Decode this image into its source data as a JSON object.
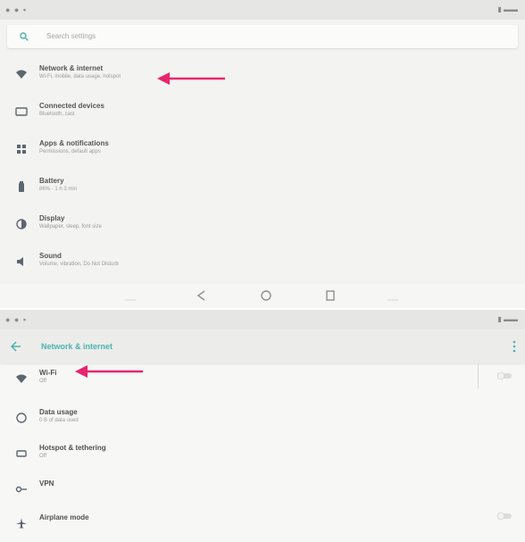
{
  "top": {
    "search_placeholder": "Search settings",
    "items": [
      {
        "title": "Network & internet",
        "summary": "Wi-Fi, mobile, data usage, hotspot",
        "icon": "wifi-icon"
      },
      {
        "title": "Connected devices",
        "summary": "Bluetooth, cast",
        "icon": "devices-icon"
      },
      {
        "title": "Apps & notifications",
        "summary": "Permissions, default apps",
        "icon": "apps-icon"
      },
      {
        "title": "Battery",
        "summary": "86% - 1 h 3 min",
        "icon": "battery-icon"
      },
      {
        "title": "Display",
        "summary": "Wallpaper, sleep, font size",
        "icon": "display-icon"
      },
      {
        "title": "Sound",
        "summary": "Volume, vibration, Do Not Disturb",
        "icon": "sound-icon"
      }
    ]
  },
  "bottom": {
    "title": "Network & internet",
    "items": [
      {
        "title": "Wi-Fi",
        "summary": "Off",
        "icon": "wifi-icon"
      },
      {
        "title": "Data usage",
        "summary": "0 B of data used",
        "icon": "data-usage-icon"
      },
      {
        "title": "Hotspot & tethering",
        "summary": "Off",
        "icon": "hotspot-icon"
      },
      {
        "title": "VPN",
        "summary": "",
        "icon": "vpn-icon"
      },
      {
        "title": "Airplane mode",
        "summary": "",
        "icon": "airplane-icon"
      }
    ]
  },
  "colors": {
    "accent": "#4ab3ad",
    "arrow": "#e8246e"
  }
}
